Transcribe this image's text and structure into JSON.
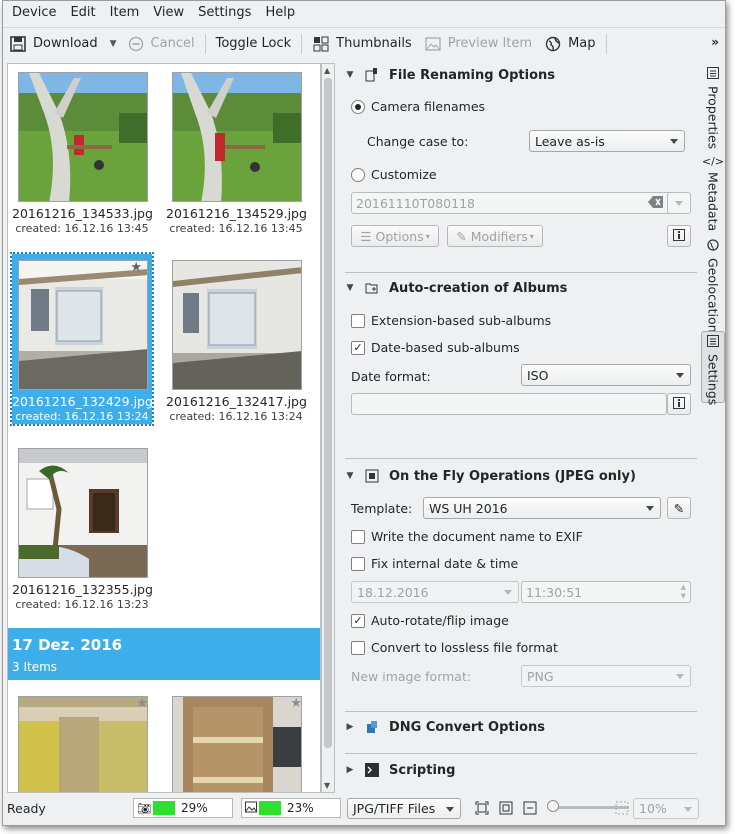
{
  "menu": [
    "Device",
    "Edit",
    "Item",
    "View",
    "Settings",
    "Help"
  ],
  "toolbar": {
    "download": "Download",
    "cancel": "Cancel",
    "toggle_lock": "Toggle Lock",
    "thumbnails": "Thumbnails",
    "preview_item": "Preview Item",
    "map": "Map",
    "more": "»"
  },
  "thumbnails": [
    {
      "name": "20161216_134533.jpg",
      "date": "created: 16.12.16 13:45"
    },
    {
      "name": "20161216_134529.jpg",
      "date": "created: 16.12.16 13:45"
    },
    {
      "name": "20161216_132429.jpg",
      "date": "created: 16.12.16 13:24"
    },
    {
      "name": "20161216_132417.jpg",
      "date": "created: 16.12.16 13:24"
    },
    {
      "name": "20161216_132355.jpg",
      "date": "created: 16.12.16 13:23"
    }
  ],
  "group": {
    "title": "17 Dez. 2016",
    "count": "3 Items"
  },
  "renaming": {
    "title": "File Renaming Options",
    "camera_filenames": "Camera filenames",
    "change_case_label": "Change case to:",
    "change_case_value": "Leave as-is",
    "customize": "Customize",
    "customize_placeholder": "20161110T080118",
    "options_button": "Options",
    "modifiers_button": "Modifiers"
  },
  "albums": {
    "title": "Auto-creation of Albums",
    "extension_based": "Extension-based sub-albums",
    "date_based": "Date-based sub-albums",
    "date_format_label": "Date format:",
    "date_format_value": "ISO"
  },
  "onthefly": {
    "title": "On the Fly Operations (JPEG only)",
    "template_label": "Template:",
    "template_value": "WS UH 2016",
    "write_doc_name": "Write the document name to EXIF",
    "fix_date": "Fix internal date & time",
    "date_value": "18.12.2016",
    "time_value": "11:30:51",
    "auto_rotate": "Auto-rotate/flip image",
    "convert_lossless": "Convert to lossless file format",
    "new_format_label": "New image format:",
    "new_format_value": "PNG"
  },
  "dng": {
    "title": "DNG Convert Options"
  },
  "scripting": {
    "title": "Scripting"
  },
  "sidetabs": [
    "Properties",
    "Metadata",
    "Geolocation",
    "Settings"
  ],
  "status": {
    "ready": "Ready",
    "progress1": "29%",
    "progress2": "23%",
    "filter": "JPG/TIFF Files",
    "zoom": "10%"
  },
  "colors": {
    "accent": "#3daee9",
    "progress": "#2ee02e"
  }
}
